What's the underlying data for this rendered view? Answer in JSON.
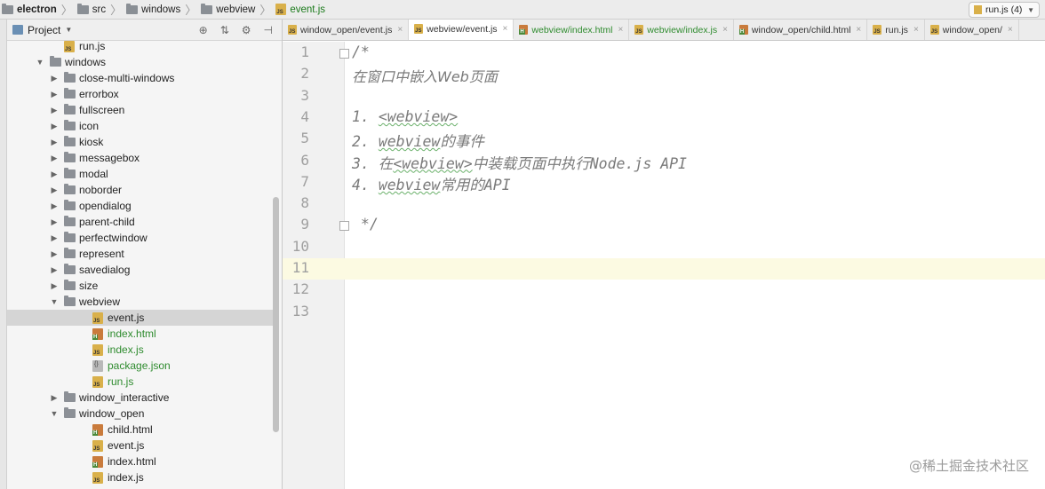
{
  "breadcrumb": {
    "items": [
      {
        "label": "electron",
        "type": "folder",
        "bold": true
      },
      {
        "label": "src",
        "type": "folder"
      },
      {
        "label": "windows",
        "type": "folder"
      },
      {
        "label": "webview",
        "type": "folder"
      },
      {
        "label": "event.js",
        "type": "js",
        "active": true
      }
    ]
  },
  "run_config": {
    "label": "run.js (4)"
  },
  "project_panel": {
    "title": "Project",
    "tools": [
      "target-icon",
      "collapse-icon",
      "gear-icon",
      "hide-icon"
    ],
    "tree": [
      {
        "label": "run.js",
        "type": "js",
        "indent": 2,
        "arrow": ""
      },
      {
        "label": "windows",
        "type": "folder",
        "indent": 1,
        "arrow": "▼"
      },
      {
        "label": "close-multi-windows",
        "type": "folder",
        "indent": 2,
        "arrow": "▶"
      },
      {
        "label": "errorbox",
        "type": "folder",
        "indent": 2,
        "arrow": "▶"
      },
      {
        "label": "fullscreen",
        "type": "folder",
        "indent": 2,
        "arrow": "▶"
      },
      {
        "label": "icon",
        "type": "folder",
        "indent": 2,
        "arrow": "▶"
      },
      {
        "label": "kiosk",
        "type": "folder",
        "indent": 2,
        "arrow": "▶"
      },
      {
        "label": "messagebox",
        "type": "folder",
        "indent": 2,
        "arrow": "▶"
      },
      {
        "label": "modal",
        "type": "folder",
        "indent": 2,
        "arrow": "▶"
      },
      {
        "label": "noborder",
        "type": "folder",
        "indent": 2,
        "arrow": "▶"
      },
      {
        "label": "opendialog",
        "type": "folder",
        "indent": 2,
        "arrow": "▶"
      },
      {
        "label": "parent-child",
        "type": "folder",
        "indent": 2,
        "arrow": "▶"
      },
      {
        "label": "perfectwindow",
        "type": "folder",
        "indent": 2,
        "arrow": "▶"
      },
      {
        "label": "represent",
        "type": "folder",
        "indent": 2,
        "arrow": "▶"
      },
      {
        "label": "savedialog",
        "type": "folder",
        "indent": 2,
        "arrow": "▶"
      },
      {
        "label": "size",
        "type": "folder",
        "indent": 2,
        "arrow": "▶"
      },
      {
        "label": "webview",
        "type": "folder",
        "indent": 2,
        "arrow": "▼"
      },
      {
        "label": "event.js",
        "type": "js",
        "indent": 3,
        "arrow": "",
        "selected": true
      },
      {
        "label": "index.html",
        "type": "html",
        "indent": 3,
        "arrow": "",
        "green": true
      },
      {
        "label": "index.js",
        "type": "js",
        "indent": 3,
        "arrow": "",
        "green": true
      },
      {
        "label": "package.json",
        "type": "json",
        "indent": 3,
        "arrow": "",
        "green": true
      },
      {
        "label": "run.js",
        "type": "js",
        "indent": 3,
        "arrow": "",
        "green": true
      },
      {
        "label": "window_interactive",
        "type": "folder",
        "indent": 2,
        "arrow": "▶"
      },
      {
        "label": "window_open",
        "type": "folder",
        "indent": 2,
        "arrow": "▼"
      },
      {
        "label": "child.html",
        "type": "html",
        "indent": 3,
        "arrow": ""
      },
      {
        "label": "event.js",
        "type": "js",
        "indent": 3,
        "arrow": ""
      },
      {
        "label": "index.html",
        "type": "html",
        "indent": 3,
        "arrow": ""
      },
      {
        "label": "index.js",
        "type": "js",
        "indent": 3,
        "arrow": ""
      }
    ]
  },
  "tabs": [
    {
      "label": "window_open/event.js",
      "type": "js"
    },
    {
      "label": "webview/event.js",
      "type": "js",
      "active": true
    },
    {
      "label": "webview/index.html",
      "type": "html",
      "green": true
    },
    {
      "label": "webview/index.js",
      "type": "js",
      "green": true
    },
    {
      "label": "window_open/child.html",
      "type": "html"
    },
    {
      "label": "run.js",
      "type": "js"
    },
    {
      "label": "window_open/",
      "type": "js"
    }
  ],
  "editor": {
    "line_numbers": [
      "1",
      "2",
      "3",
      "4",
      "5",
      "6",
      "7",
      "8",
      "9",
      "10",
      "11",
      "12",
      "13"
    ],
    "lines": [
      {
        "text": "/*",
        "cn": false
      },
      {
        "text": "在窗口中嵌入Web页面",
        "cn": true
      },
      {
        "text": "",
        "cn": false
      },
      {
        "pre": "1. ",
        "wavy": "<webview>",
        "post": "",
        "cn": false
      },
      {
        "pre": "2. ",
        "wavy": "webview",
        "post": "的事件",
        "cn": false
      },
      {
        "pre": "3. 在",
        "wavy": "<webview>",
        "post": "中装载页面中执行Node.js API",
        "cn": false
      },
      {
        "pre": "4. ",
        "wavy": "webview",
        "post": "常用的API",
        "cn": false
      },
      {
        "text": "",
        "cn": false
      },
      {
        "text": " */",
        "cn": false
      },
      {
        "text": "",
        "cn": false
      },
      {
        "text": "",
        "cn": false
      },
      {
        "text": "",
        "cn": false
      },
      {
        "text": "",
        "cn": false
      }
    ],
    "current_line": 11
  },
  "watermark": "@稀土掘金技术社区"
}
